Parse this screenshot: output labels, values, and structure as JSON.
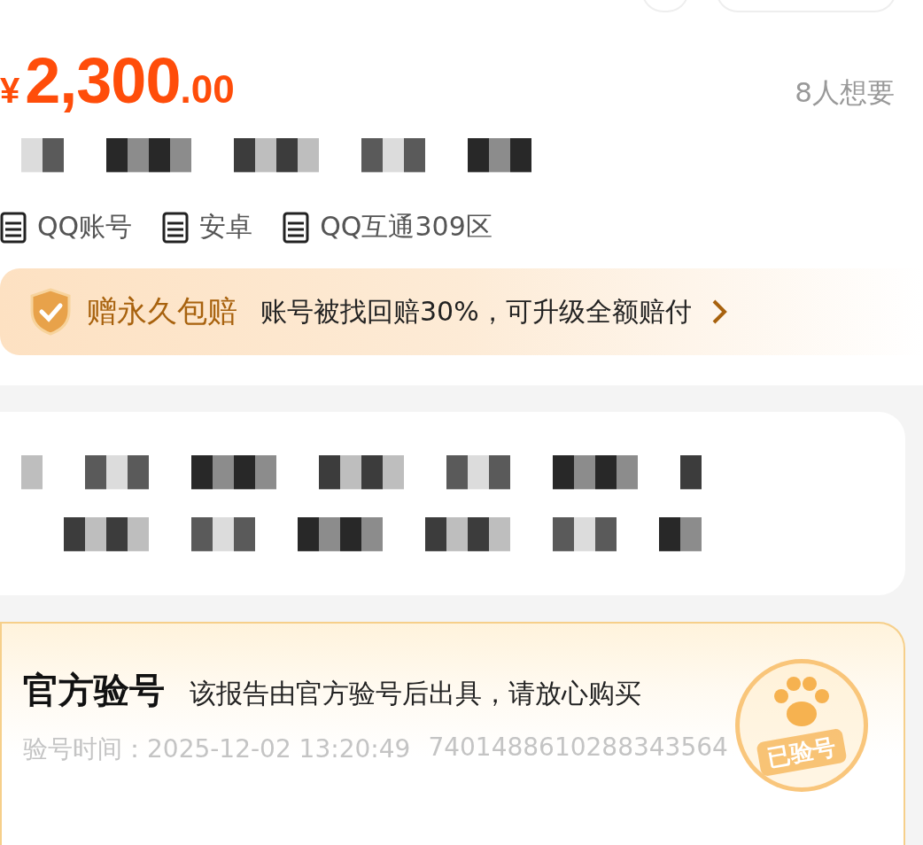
{
  "price": {
    "currency": "¥",
    "integer": "2,300",
    "decimal": ".00"
  },
  "wants": "8人想要",
  "tags": [
    "QQ账号",
    "安卓",
    "QQ互通309区"
  ],
  "guarantee": {
    "title": "赠永久包赔",
    "text": "账号被找回赔30%，可升级全额赔付"
  },
  "verification": {
    "title": "官方验号",
    "subtitle": "该报告由官方验号后出具，请放心购买",
    "time_label": "验号时间：",
    "time": "2025-12-02 13:20:49",
    "id": "7401488610288343564",
    "stamp": "已验号"
  }
}
